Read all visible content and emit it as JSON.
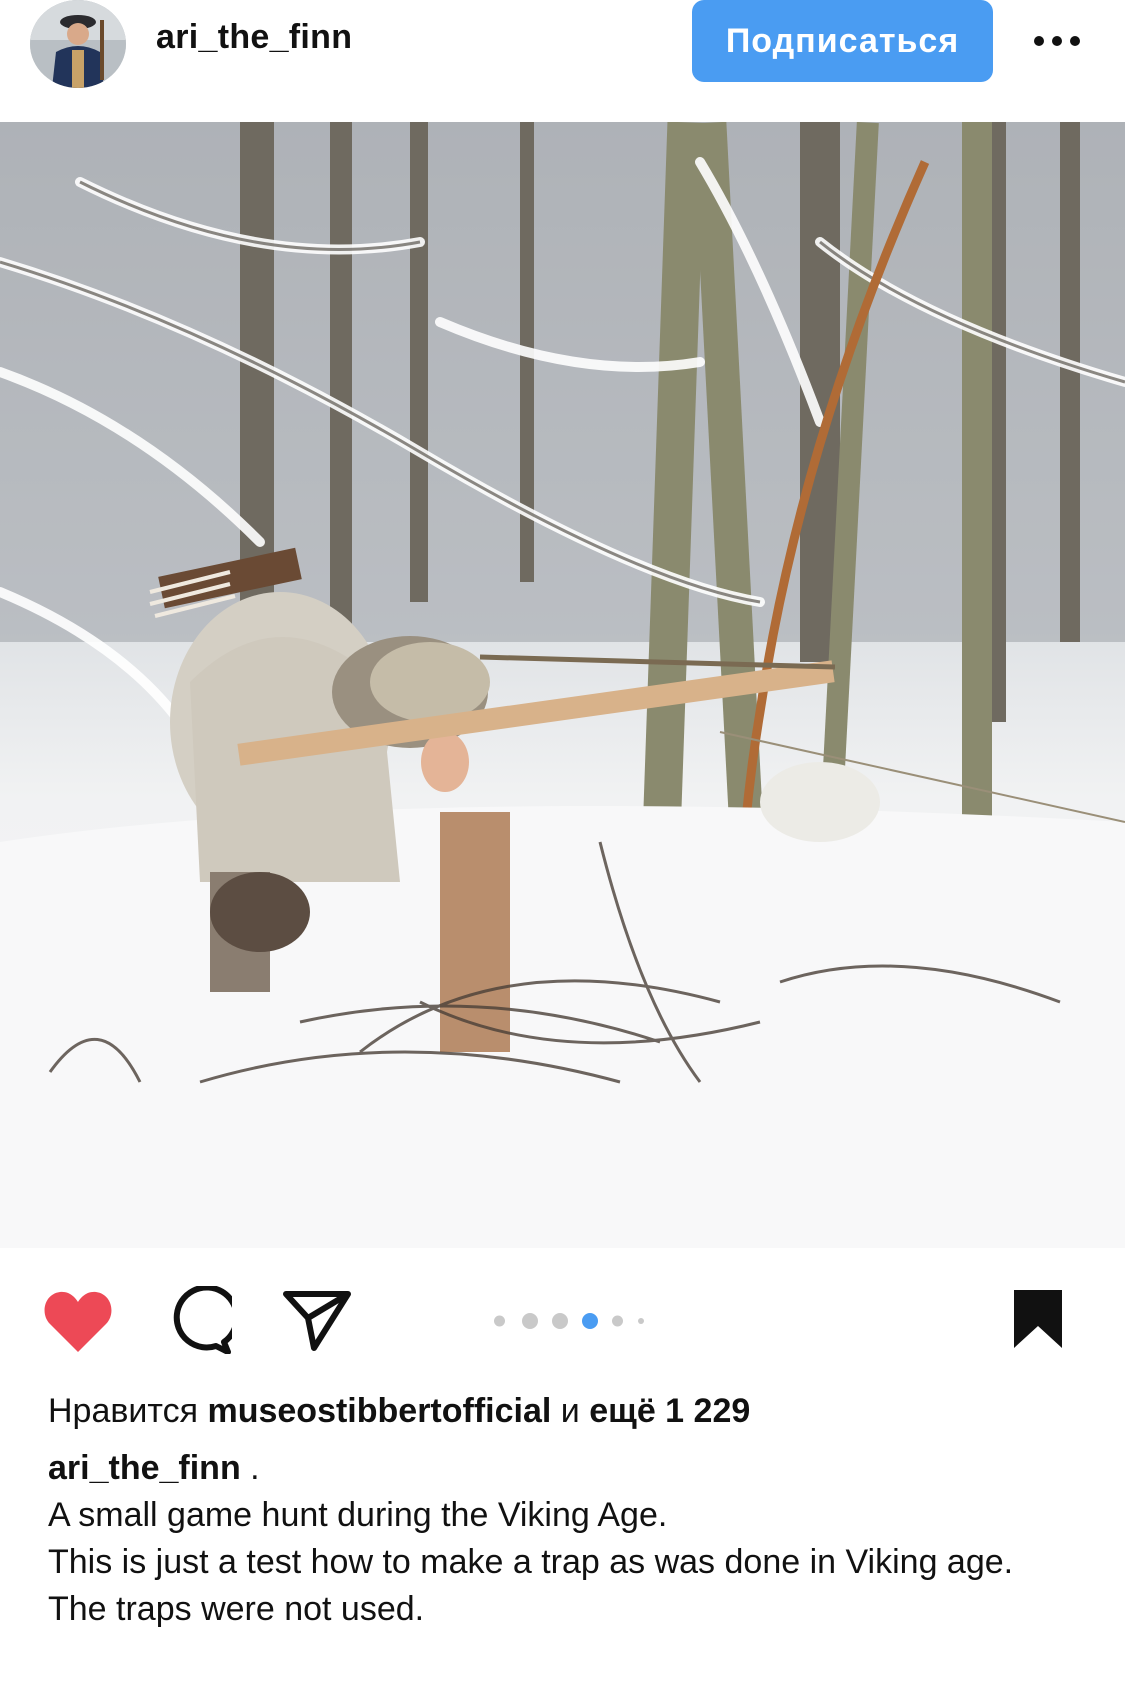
{
  "header": {
    "username": "ari_the_finn",
    "follow_label": "Подписаться"
  },
  "photo": {
    "description_icon": "photo-image"
  },
  "actions": {
    "like_icon": "heart-filled-icon",
    "comment_icon": "comment-icon",
    "share_icon": "send-icon",
    "save_icon": "bookmark-filled-icon",
    "carousel_count": 6,
    "carousel_active_index": 3,
    "like_color": "#ed4956",
    "accent_color": "#4a9cf2"
  },
  "likes": {
    "prefix": "Нравится",
    "liker": "museostibbertofficial",
    "conjunction": "и",
    "more": "ещё 1 229"
  },
  "caption": {
    "username": "ari_the_finn",
    "username_suffix": " .",
    "lines": [
      "A small game hunt during the Viking Age.",
      "This is just a test how to make a trap as was done in Viking age.",
      "The traps were not used."
    ]
  }
}
